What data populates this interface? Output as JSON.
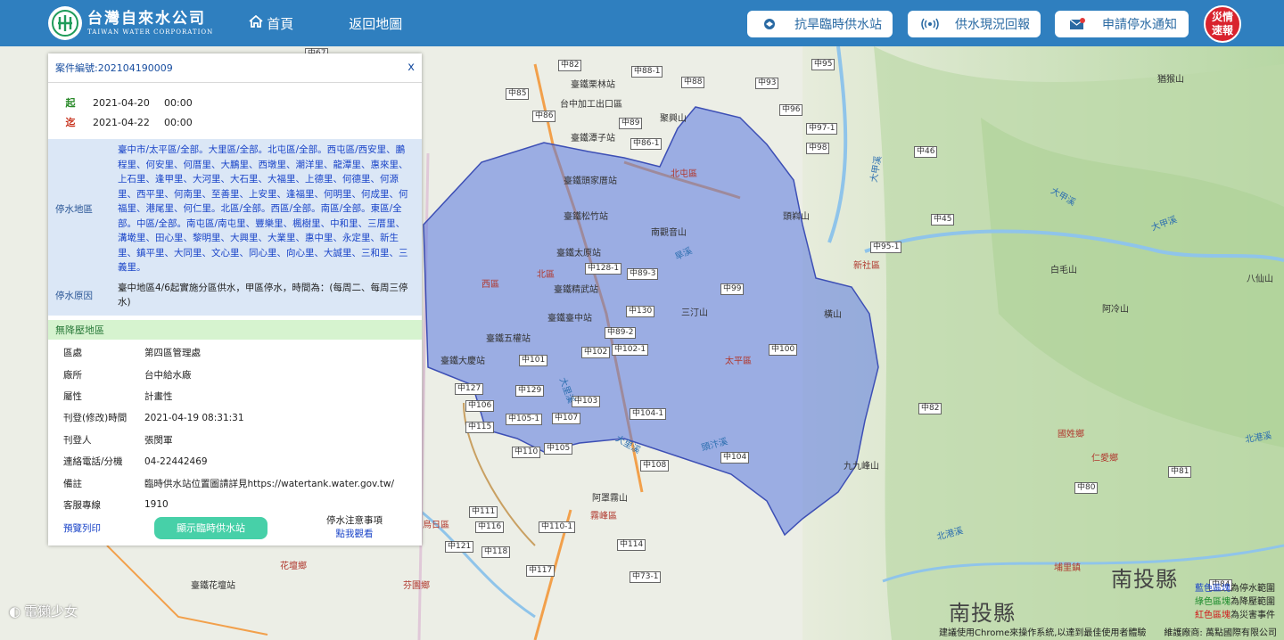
{
  "header": {
    "logo_cn": "台灣自來水公司",
    "logo_en": "TAIWAN WATER CORPORATION",
    "nav_home": "首頁",
    "nav_map": "返回地圖",
    "btn_drought": "抗旱臨時供水站",
    "btn_report": "供水現況回報",
    "btn_notice": "申請停水通知",
    "disaster_line1": "災情",
    "disaster_line2": "速報",
    "brand_color": "#2f7fbf",
    "disaster_color": "#d9232e"
  },
  "panel": {
    "case_label": "案件編號:202104190009",
    "close": "x",
    "start_tag": "起",
    "start_date": "2021-04-20",
    "start_time": "00:00",
    "end_tag": "迄",
    "end_date": "2021-04-22",
    "end_time": "00:00",
    "area_label": "停水地區",
    "area_text": "臺中市/太平區/全部。大里區/全部。北屯區/全部。西屯區/西安里、鵬程里、何安里、何厝里、大鵬里、西墩里、潮洋里、龍潭里、惠來里、上石里、逢甲里、大河里、大石里、大福里、上德里、何德里、何源里、西平里、何南里、至善里、上安里、逢福里、何明里、何成里、何福里、港尾里、何仁里。北區/全部。西區/全部。南區/全部。東區/全部。中區/全部。南屯區/南屯里、豐樂里、楓樹里、中和里、三厝里、溝墘里、田心里、黎明里、大興里、大業里、惠中里、永定里、新生里、鎮平里、大同里、文心里、同心里、向心里、大誠里、三和里、三義里。",
    "reason_label": "停水原因",
    "reason_text": "臺中地區4/6起實施分區供水，甲區停水，時間為：(每周二、每周三停水)",
    "nopress_label": "無降壓地區",
    "info": [
      {
        "k": "區處",
        "v": "第四區管理處"
      },
      {
        "k": "廠所",
        "v": "台中給水廠"
      },
      {
        "k": "屬性",
        "v": "計畫性"
      },
      {
        "k": "刊登(修改)時間",
        "v": "2021-04-19 08:31:31"
      },
      {
        "k": "刊登人",
        "v": "張閔軍"
      },
      {
        "k": "連絡電話/分機",
        "v": "04-22442469"
      },
      {
        "k": "備註",
        "v": "臨時供水站位置圖請詳見https://watertank.water.gov.tw/"
      },
      {
        "k": "客服專線",
        "v": "1910"
      }
    ],
    "print_link": "預覽列印",
    "show_station_btn": "顯示臨時供水站",
    "notes_title": "停水注意事項",
    "notes_link": "點我觀看"
  },
  "map": {
    "districts": {
      "beitun": "北屯區",
      "taiping": "太平區",
      "xinshe": "新社區",
      "north": "北區",
      "west": "西區",
      "guoxing": "國姓鄉",
      "renai": "仁愛鄉",
      "puli": "埔里鎮",
      "wuri": "烏日區",
      "fenyuan": "芬園鄉",
      "wufeng": "霧峰區",
      "huatan": "花壇鄉"
    },
    "counties": {
      "nantou_right": "南投縣",
      "nantou_bottom": "南投縣"
    },
    "roads": [
      "中67",
      "中82",
      "中88",
      "中85",
      "中86",
      "中89",
      "中86-1",
      "中93",
      "中95",
      "中96",
      "中97-1",
      "中98",
      "中46",
      "中45",
      "中95-1",
      "中128-1",
      "中89-3",
      "中99",
      "中130",
      "中89-2",
      "中102-1",
      "中102",
      "中100",
      "中101",
      "中129",
      "中103",
      "中104-1",
      "中105-1",
      "中107",
      "中105",
      "中110",
      "中106",
      "中115",
      "中108",
      "中104",
      "中127",
      "中111",
      "中116",
      "中110-1",
      "中121",
      "中114",
      "中118",
      "中117",
      "中73-1",
      "中84",
      "中80",
      "中81",
      "中82"
    ],
    "stations": [
      "臺鐵栗林站",
      "台中加工出口區",
      "臺鐵潭子站",
      "臺鐵頭家厝站",
      "臺鐵松竹站",
      "臺鐵太原站",
      "臺鐵精武站",
      "臺鐵臺中站",
      "臺鐵五權站",
      "臺鐵大慶站",
      "臺鐵花壇站"
    ],
    "mountains": [
      "聚興山",
      "頭嵙山",
      "南觀音山",
      "三汀山",
      "橫山",
      "白毛山",
      "阿冷山",
      "八仙山",
      "猶猴山",
      "九九峰山",
      "阿罩霧山"
    ],
    "rivers": [
      "大甲溪",
      "大里溪",
      "北港溪",
      "頭汴溪",
      "旱溪"
    ],
    "legend": {
      "blue": "藍色區塊",
      "blue_desc": "為停水範圍",
      "green": "綠色區塊",
      "green_desc": "為降壓範圍",
      "red": "紅色區塊",
      "red_desc": "為災害事件"
    },
    "footer": "建議使用Chrome來操作系統,以達到最佳使用者體驗　　維護廠商: 萬點國際有限公司",
    "watermark": "電獺少女",
    "outage_color": "#5a78e0"
  }
}
